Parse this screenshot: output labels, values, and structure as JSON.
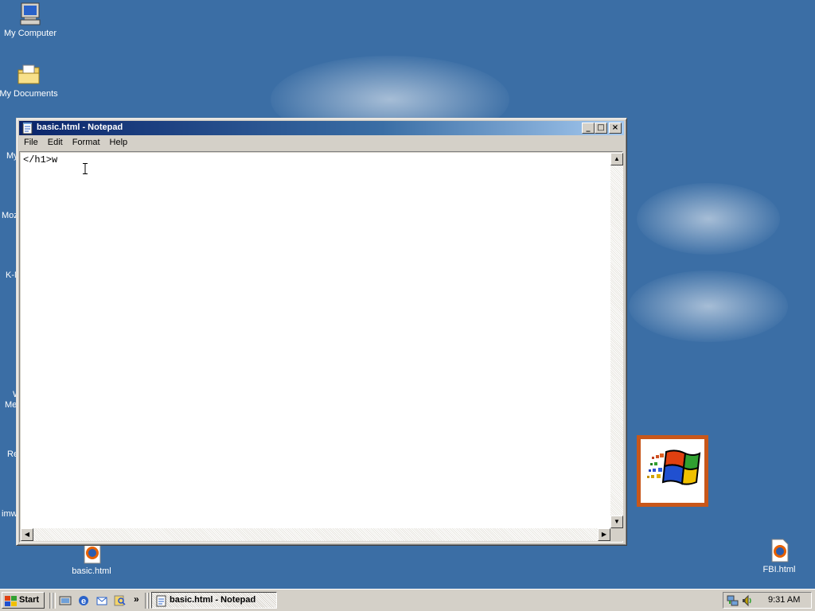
{
  "desktop": {
    "background_color": "#3b6ea5",
    "icons": [
      {
        "label": "My Computer",
        "icon": "my-computer-icon"
      },
      {
        "label": "My Documents",
        "icon": "my-documents-icon"
      },
      {
        "label": "basic.html",
        "icon": "firefox-html-icon"
      },
      {
        "label": "FBI.html",
        "icon": "firefox-html-icon"
      }
    ],
    "partial_labels": [
      "My",
      "Moz",
      "K-M",
      "W",
      "Me",
      "Re",
      "imw"
    ]
  },
  "notepad": {
    "title": "basic.html - Notepad",
    "menu": [
      "File",
      "Edit",
      "Format",
      "Help"
    ],
    "content": "</h1>w",
    "caption_buttons": {
      "minimize": "_",
      "maximize": "□",
      "close": "×"
    }
  },
  "taskbar": {
    "start_label": "Start",
    "quick_launch": [
      "show-desktop-icon",
      "internet-explorer-icon",
      "outlook-express-icon",
      "search-icon"
    ],
    "chevron": "»",
    "task_button_label": "basic.html - Notepad",
    "tray_icons": [
      "network-icon",
      "volume-icon"
    ],
    "clock": "9:31 AM"
  }
}
